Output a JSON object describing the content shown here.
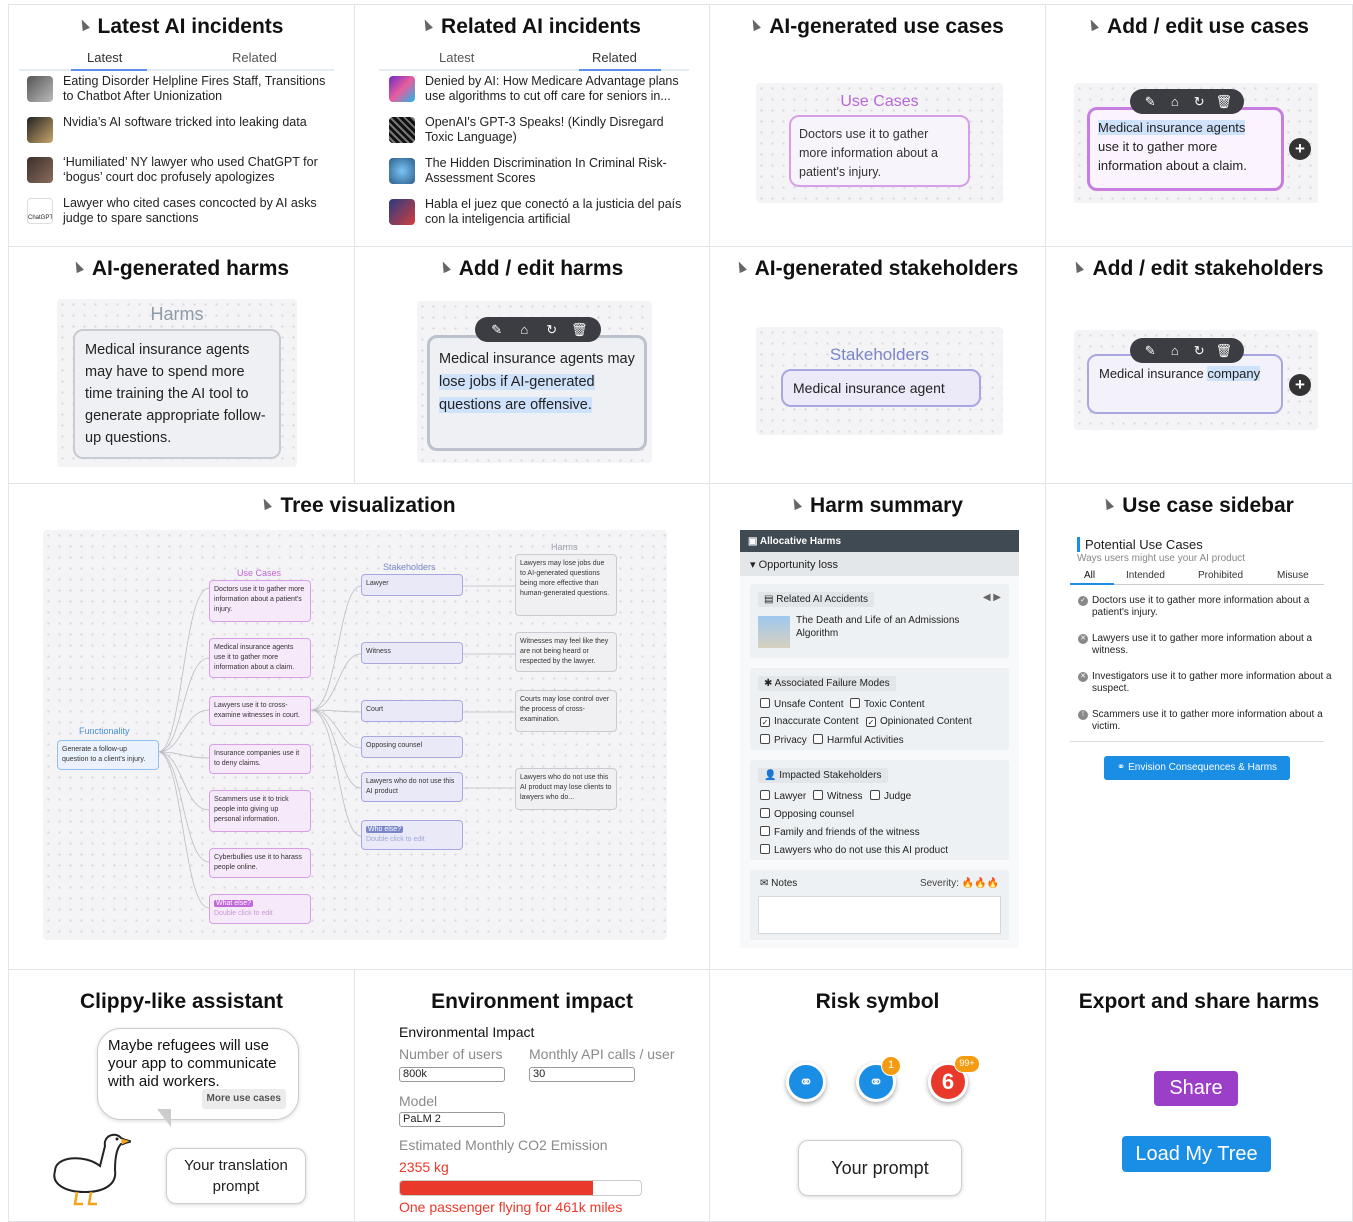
{
  "cells": {
    "latest": {
      "title": "Latest AI incidents",
      "tabs": [
        "Latest",
        "Related"
      ],
      "items": [
        "Eating Disorder Helpline Fires Staff, Transitions to Chatbot After Unionization",
        "Nvidia’s AI software tricked into leaking data",
        "‘Humiliated’ NY lawyer who used ChatGPT for ‘bogus’ court doc profusely apologizes",
        "Lawyer who cited cases concocted by AI asks judge to spare sanctions"
      ],
      "thumb_label": "ChatGPT"
    },
    "related": {
      "title": "Related AI incidents",
      "tabs": [
        "Latest",
        "Related"
      ],
      "items": [
        "Denied by AI: How Medicare Advantage plans use algorithms to cut off care for seniors in...",
        "OpenAI's GPT-3 Speaks! (Kindly Disregard Toxic Language)",
        "The Hidden Discrimination In Criminal Risk-Assessment Scores",
        "Habla el juez que conectó a la justicia del país con la inteligencia artificial"
      ]
    },
    "ai_uc": {
      "title": "AI-generated use cases",
      "node_label": "Use Cases",
      "text": "Doctors use it to gather more information about a patient's injury."
    },
    "edit_uc": {
      "title": "Add / edit use cases",
      "line1": "Medical insurance agents",
      "line2": "use it to gather more",
      "line3": "information about a claim."
    },
    "ai_harm": {
      "title": "AI-generated harms",
      "node_label": "Harms",
      "text": "Medical insurance agents may have to spend more time training the AI tool to generate appropriate follow-up questions."
    },
    "edit_harm": {
      "title": "Add / edit harms",
      "plain": "Medical insurance agents may ",
      "highlighted": "lose jobs if AI-generated questions are offensive."
    },
    "ai_sh": {
      "title": "AI-generated stakeholders",
      "node_label": "Stakeholders",
      "text": "Medical insurance agent"
    },
    "edit_sh": {
      "title": "Add / edit stakeholders",
      "plain": "Medical insurance ",
      "highlighted": "company"
    },
    "tree": {
      "title": "Tree visualization",
      "col_labels": {
        "functionality": "Functionality",
        "use_cases": "Use Cases",
        "stakeholders": "Stakeholders",
        "harms": "Harms"
      },
      "functionality": "Generate a follow-up question to a client's injury.",
      "use_cases": [
        "Doctors use it to gather more information about a patient's injury.",
        "Medical insurance agents use it to gather more information about a claim.",
        "Lawyers use it to cross-examine witnesses in court.",
        "Insurance companies use it to deny claims.",
        "Scammers use it to trick people into giving up personal information.",
        "Cyberbullies use it to harass people online."
      ],
      "uc_more": {
        "label": "What else?",
        "hint": "Double click to edit"
      },
      "stakeholders": [
        "Lawyer",
        "Witness",
        "Court",
        "Opposing counsel",
        "Lawyers who do not use this AI product"
      ],
      "sh_more": {
        "label": "Who else?",
        "hint": "Double click to edit"
      },
      "harms": [
        "Lawyers may lose jobs due to AI-generated questions being more effective than human-generated questions.",
        "Witnesses may feel like they are not being heard or respected by the lawyer.",
        "Courts may lose control over the process of cross-examination.",
        "Lawyers who do not use this AI product may lose clients to lawyers who do..."
      ]
    },
    "harm_summary": {
      "title": "Harm summary",
      "header": "Allocative Harms",
      "sub": "Opportunity loss",
      "related_label": "Related AI Accidents",
      "related_item": "The Death and Life of an Admissions Algorithm",
      "failure_label": "Associated Failure Modes",
      "failure_modes": [
        {
          "label": "Unsafe Content",
          "checked": false
        },
        {
          "label": "Toxic Content",
          "checked": false
        },
        {
          "label": "Inaccurate Content",
          "checked": true
        },
        {
          "label": "Opinionated Content",
          "checked": true
        },
        {
          "label": "Privacy",
          "checked": false
        },
        {
          "label": "Harmful Activities",
          "checked": false
        }
      ],
      "stake_label": "Impacted Stakeholders",
      "stakeholders": [
        {
          "label": "Lawyer"
        },
        {
          "label": "Witness"
        },
        {
          "label": "Judge"
        },
        {
          "label": "Opposing counsel"
        },
        {
          "label": "Family and friends of the witness"
        },
        {
          "label": "Lawyers who do not use this AI product"
        }
      ],
      "notes_label": "Notes",
      "severity_label": "Severity:"
    },
    "uc_sidebar": {
      "title": "Use case sidebar",
      "heading": "Potential Use Cases",
      "subtitle": "Ways users might use your AI product",
      "tabs": [
        "All",
        "Intended",
        "Prohibited",
        "Misuse"
      ],
      "items": [
        "Doctors use it to gather more information about a patient's injury.",
        "Lawyers use it to gather more information about a witness.",
        "Investigators use it to gather more information about a suspect.",
        "Scammers use it to gather more information about a victim."
      ],
      "button": "Envision Consequences & Harms"
    },
    "clippy": {
      "title": "Clippy-like assistant",
      "bubble": "Maybe refugees will use your app to communicate with aid workers.",
      "more": "More use cases",
      "prompt": "Your translation prompt"
    },
    "env": {
      "title": "Environment impact",
      "heading": "Environmental Impact",
      "users_label": "Number of users",
      "api_label": "Monthly API calls / user",
      "users": "800k",
      "api": "30",
      "model_label": "Model",
      "model": "PaLM 2",
      "co2_label": "Estimated Monthly CO2 Emission",
      "co2": "2355 kg",
      "bar_fraction": 0.8,
      "comparison": "One passenger flying for 461k miles"
    },
    "risk": {
      "title": "Risk symbol",
      "badge1": "1",
      "count": "6",
      "badge2": "99+",
      "prompt": "Your prompt"
    },
    "export": {
      "title": "Export and share harms",
      "share": "Share",
      "load": "Load My Tree"
    }
  },
  "colors": {
    "purple": "#9b3fc8",
    "blue": "#1a8de4",
    "red": "#e8392b",
    "accent": "#5b8ff0"
  }
}
